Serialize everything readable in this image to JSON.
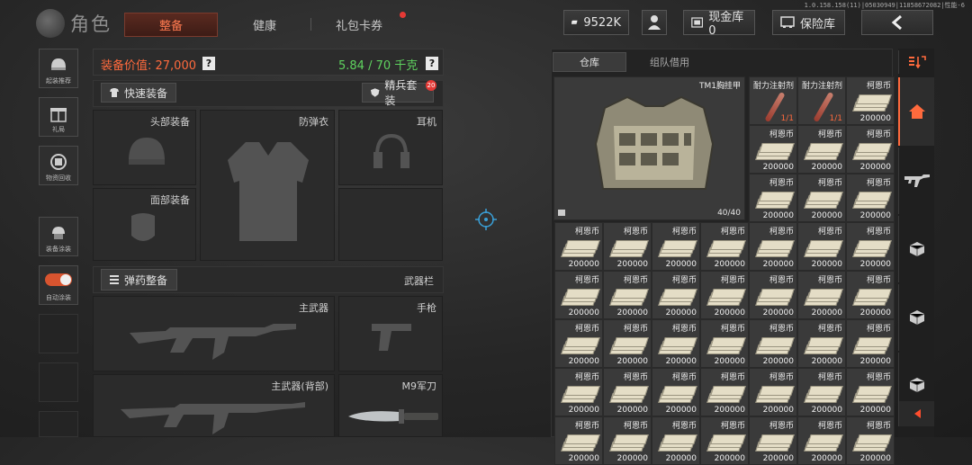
{
  "version": "1.0.158.158(11)|05030949|11858672082|性能-6",
  "header": {
    "title": "角色",
    "tabs": [
      {
        "label": "整备",
        "active": true
      },
      {
        "label": "健康",
        "active": false
      },
      {
        "label": "礼包卡券",
        "active": false,
        "has_notification": true
      }
    ],
    "currency_value": "9522K",
    "cash_storage_label": "现金库 0",
    "vault_label": "保险库",
    "back_icon": "chevron-left-icon"
  },
  "sidebar": {
    "items": [
      {
        "label": "起装推荐",
        "icon": "helmet-icon"
      },
      {
        "label": "礼局",
        "icon": "gift-icon"
      },
      {
        "label": "物资回收",
        "icon": "recycle-icon"
      },
      {
        "label": "装备涂装",
        "icon": "paint-icon"
      },
      {
        "label": "自动涂装",
        "icon": "toggle-icon",
        "toggle_on": true
      }
    ]
  },
  "equipment": {
    "value_label": "装备价值: 27,000",
    "weight_label": "5.84 / 70 千克",
    "quick_equip_label": "快速装备",
    "elite_kit_label": "精兵套装",
    "elite_kit_badge": "20",
    "slots": {
      "head": "头部装备",
      "armor": "防弹衣",
      "headset": "耳机",
      "face": "面部装备"
    },
    "ammo_label": "弹药整备",
    "weapon_bar_label": "武器栏",
    "weapons": {
      "primary": "主武器",
      "pistol": "手枪",
      "primary_back": "主武器(背部)",
      "melee": "M9军刀"
    }
  },
  "inventory": {
    "tabs": [
      {
        "label": "仓库",
        "active": true
      },
      {
        "label": "组队借用",
        "active": false
      }
    ],
    "rig": {
      "name": "TM1胸挂甲",
      "capacity": "40/40"
    },
    "syringe_name": "耐力注射剂",
    "syringe_count": "1/1",
    "money_name": "柯恩币",
    "money_value": "200000"
  },
  "right_tabs": [
    "sort-icon",
    "home-icon",
    "rifle-icon",
    "box-icon",
    "box-icon",
    "box-icon",
    "collapse-arrow-icon"
  ],
  "colors": {
    "accent": "#ff6a3d",
    "weight_green": "#5fd35f",
    "active_tab_bg": "#4a221a"
  }
}
